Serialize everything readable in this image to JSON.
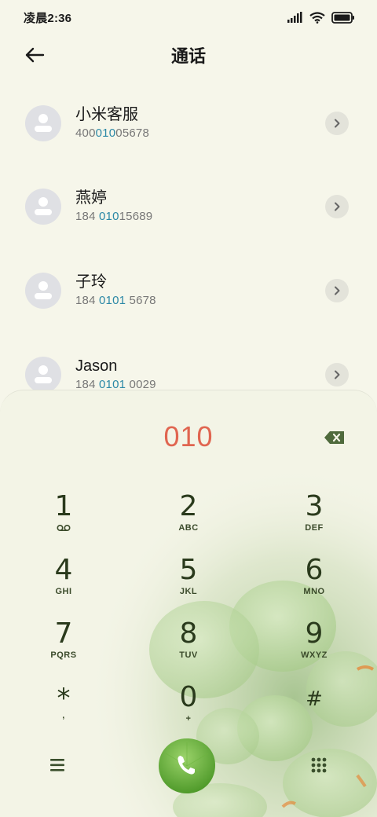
{
  "status": {
    "time": "凌晨2:36"
  },
  "header": {
    "title": "通话"
  },
  "contacts": [
    {
      "name": "小米客服",
      "number_pre": "400",
      "number_hl": "010",
      "number_post": "05678"
    },
    {
      "name": "燕婷",
      "number_pre": "184 ",
      "number_hl": "010",
      "number_post": "15689"
    },
    {
      "name": "子玲",
      "number_pre": "184 ",
      "number_hl": "0101",
      "number_post": " 5678"
    },
    {
      "name": "Jason",
      "number_pre": "184 ",
      "number_hl": "0101",
      "number_post": " 0029"
    }
  ],
  "dialer": {
    "entered_number": "010",
    "keys": [
      {
        "digit": "1",
        "letters": ""
      },
      {
        "digit": "2",
        "letters": "ABC"
      },
      {
        "digit": "3",
        "letters": "DEF"
      },
      {
        "digit": "4",
        "letters": "GHI"
      },
      {
        "digit": "5",
        "letters": "JKL"
      },
      {
        "digit": "6",
        "letters": "MNO"
      },
      {
        "digit": "7",
        "letters": "PQRS"
      },
      {
        "digit": "8",
        "letters": "TUV"
      },
      {
        "digit": "9",
        "letters": "WXYZ"
      },
      {
        "digit": "*",
        "letters": ","
      },
      {
        "digit": "0",
        "letters": "+"
      },
      {
        "digit": "#",
        "letters": ""
      }
    ]
  },
  "icons": {
    "back": "back-arrow-icon",
    "voicemail": "voicemail-icon",
    "backspace": "backspace-icon",
    "menu": "menu-icon",
    "call": "phone-icon",
    "keypad": "keypad-grid-icon"
  },
  "colors": {
    "accent": "#e06550",
    "highlight": "#2b88a6",
    "call": "#5fae3a"
  }
}
